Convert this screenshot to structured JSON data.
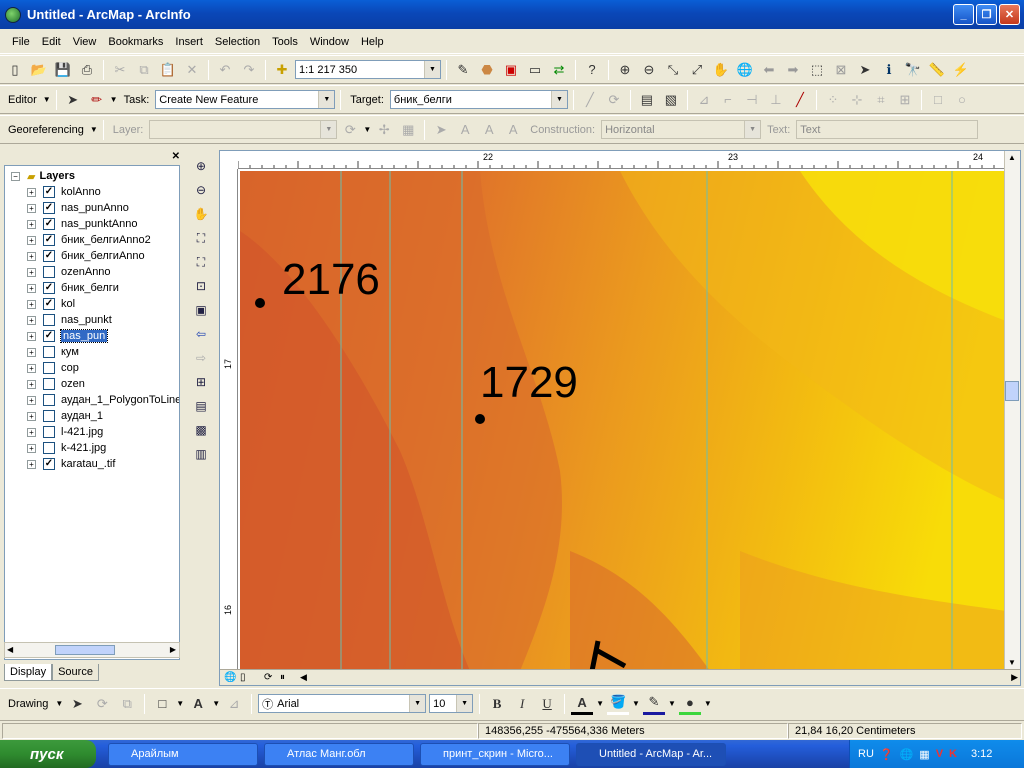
{
  "window": {
    "title": "Untitled - ArcMap - ArcInfo"
  },
  "menu": [
    "File",
    "Edit",
    "View",
    "Bookmarks",
    "Insert",
    "Selection",
    "Tools",
    "Window",
    "Help"
  ],
  "standard_toolbar": {
    "scale": "1:1 217 350"
  },
  "editor_toolbar": {
    "editor_label": "Editor",
    "task_label": "Task:",
    "task_value": "Create New Feature",
    "target_label": "Target:",
    "target_value": "бник_белги"
  },
  "georef_toolbar": {
    "georef_label": "Georeferencing",
    "layer_label": "Layer:",
    "construction_label": "Construction:",
    "construction_value": "Horizontal",
    "text_label": "Text:",
    "text_value": "Text"
  },
  "toc": {
    "root": "Layers",
    "layers": [
      {
        "name": "kolAnno",
        "checked": true
      },
      {
        "name": "nas_punAnno",
        "checked": true
      },
      {
        "name": "nas_punktAnno",
        "checked": true
      },
      {
        "name": "бник_белгиAnno2",
        "checked": true
      },
      {
        "name": "бник_белгиAnno",
        "checked": true
      },
      {
        "name": "ozenAnno",
        "checked": false
      },
      {
        "name": "бник_белги",
        "checked": true
      },
      {
        "name": "kol",
        "checked": true
      },
      {
        "name": "nas_punkt",
        "checked": false
      },
      {
        "name": "nas_pun",
        "checked": true,
        "selected": true
      },
      {
        "name": "кум",
        "checked": false
      },
      {
        "name": "сор",
        "checked": false
      },
      {
        "name": "ozen",
        "checked": false
      },
      {
        "name": "аудан_1_PolygonToLine",
        "checked": false
      },
      {
        "name": "аудан_1",
        "checked": false
      },
      {
        "name": "l-421.jpg",
        "checked": false
      },
      {
        "name": "k-421.jpg",
        "checked": false
      },
      {
        "name": "karatau_.tif",
        "checked": true
      }
    ],
    "tabs": [
      "Display",
      "Source"
    ]
  },
  "map": {
    "ruler_top": [
      "22",
      "23",
      "24"
    ],
    "ruler_left": [
      "17",
      "16"
    ],
    "labels": [
      {
        "text": "2176"
      },
      {
        "text": "1729"
      }
    ]
  },
  "drawing_toolbar": {
    "drawing_label": "Drawing",
    "font": "Arial",
    "size": "10",
    "bold": "B",
    "italic": "I",
    "underline": "U",
    "font_color": "A"
  },
  "status": {
    "coords": "148356,255  -475564,336 Meters",
    "page": "21,84  16,20 Centimeters"
  },
  "taskbar": {
    "start": "пуск",
    "tasks": [
      "Арайлым",
      "Атлас Манг.обл",
      "принт_скрин - Micro...",
      "Untitled - ArcMap - Ar..."
    ],
    "lang": "RU",
    "clock": "3:12"
  }
}
